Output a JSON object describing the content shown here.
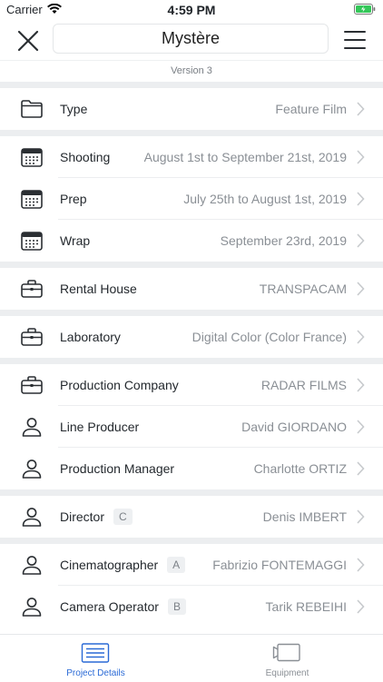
{
  "status_bar": {
    "carrier": "Carrier",
    "time": "4:59 PM"
  },
  "header": {
    "title": "Mystère",
    "version": "Version 3"
  },
  "rows": [
    {
      "icon": "folder-icon",
      "label": "Type",
      "value": "Feature Film"
    },
    {
      "icon": "calendar-icon",
      "label": "Shooting",
      "value": "August 1st to September 21st, 2019"
    },
    {
      "icon": "calendar-icon",
      "label": "Prep",
      "value": "July 25th to August 1st, 2019"
    },
    {
      "icon": "calendar-icon",
      "label": "Wrap",
      "value": "September 23rd, 2019"
    },
    {
      "icon": "briefcase-icon",
      "label": "Rental House",
      "value": "TRANSPACAM"
    },
    {
      "icon": "briefcase-icon",
      "label": "Laboratory",
      "value": "Digital Color (Color France)"
    },
    {
      "icon": "briefcase-icon",
      "label": "Production Company",
      "value": "RADAR FILMS"
    },
    {
      "icon": "person-icon",
      "label": "Line Producer",
      "value": "David GIORDANO"
    },
    {
      "icon": "person-icon",
      "label": "Production Manager",
      "value": "Charlotte ORTIZ"
    },
    {
      "icon": "person-icon",
      "label": "Director",
      "badge": "C",
      "value": "Denis IMBERT"
    },
    {
      "icon": "person-icon",
      "label": "Cinematographer",
      "badge": "A",
      "value": "Fabrizio FONTEMAGGI"
    },
    {
      "icon": "person-icon",
      "label": "Camera Operator",
      "badge": "B",
      "value": "Tarik REBEIHI"
    }
  ],
  "tabs": [
    {
      "label": "Project Details",
      "icon": "details-icon",
      "active": true
    },
    {
      "label": "Equipment",
      "icon": "equipment-icon",
      "active": false
    }
  ],
  "colors": {
    "accent": "#2a6ad6",
    "icon": "#2b2f33",
    "muted": "#8a8f95",
    "separator": "#eceef0"
  }
}
